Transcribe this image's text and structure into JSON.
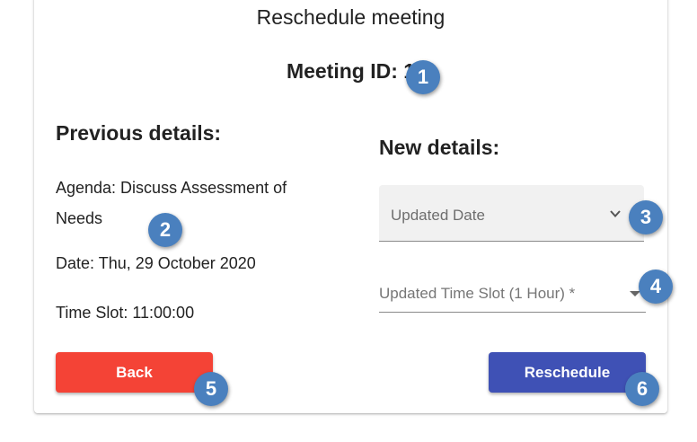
{
  "dialog": {
    "title": "Reschedule meeting",
    "meeting_id": "Meeting ID: 1"
  },
  "previous": {
    "heading": "Previous details:",
    "agenda": "Agenda: Discuss Assessment of Needs",
    "date": "Date: Thu, 29 October 2020",
    "time_slot": "Time Slot: 11:00:00"
  },
  "new_details": {
    "heading": "New details:",
    "date_field": {
      "placeholder": "Updated Date",
      "icon": "chevron-down-icon"
    },
    "time_field": {
      "placeholder": "Updated Time Slot (1 Hour) *",
      "icon": "dropdown-arrow-icon"
    }
  },
  "buttons": {
    "back_label": "Back",
    "reschedule_label": "Reschedule",
    "back_color": "#f44336",
    "reschedule_color": "#3f51b5"
  },
  "badges": [
    "1",
    "2",
    "3",
    "4",
    "5",
    "6"
  ],
  "badge_color": "#4a80be"
}
